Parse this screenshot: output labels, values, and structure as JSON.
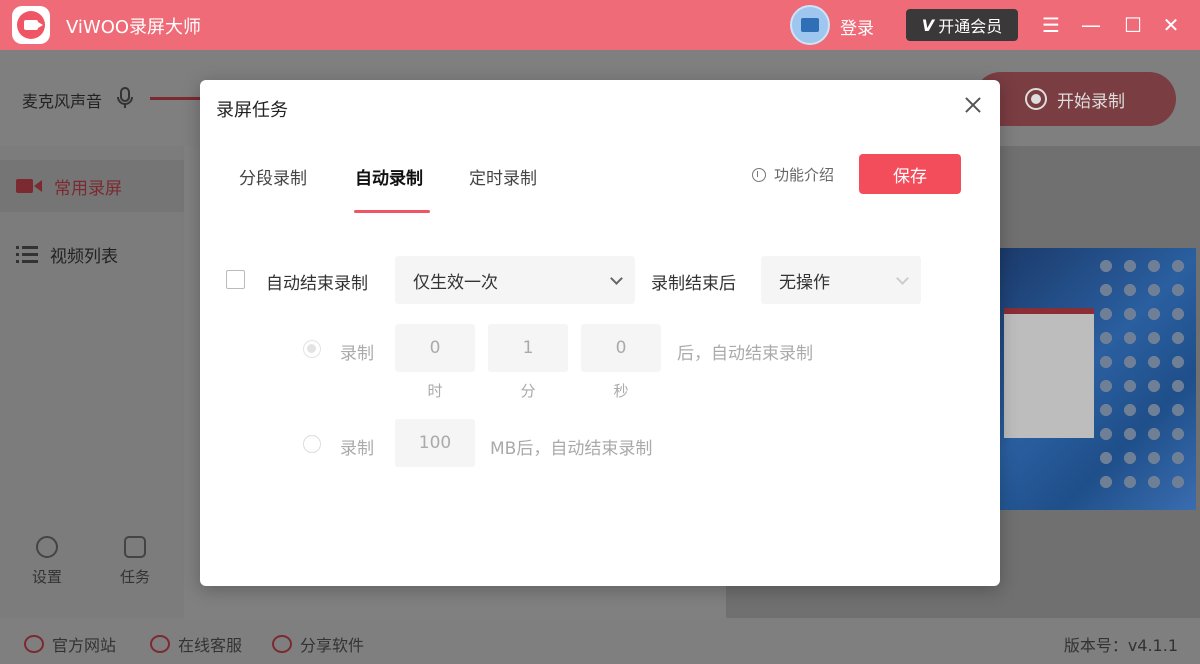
{
  "app": {
    "title": "ViWOO录屏大师",
    "login": "登录",
    "vip": "开通会员",
    "vip_mark": "V"
  },
  "toolbar": {
    "mic_label": "麦克风声音",
    "start_record": "开始录制"
  },
  "sidebar": {
    "items": [
      {
        "label": "常用录屏"
      },
      {
        "label": "视频列表"
      }
    ],
    "settings": "设置",
    "tasks": "任务"
  },
  "footer": {
    "official_site": "官方网站",
    "support": "在线客服",
    "share": "分享软件",
    "version": "版本号：v4.1.1"
  },
  "modal": {
    "title": "录屏任务",
    "tabs": [
      {
        "label": "分段录制"
      },
      {
        "label": "自动录制"
      },
      {
        "label": "定时录制"
      }
    ],
    "active_tab": "自动录制",
    "feature_intro": "功能介绍",
    "save": "保存",
    "auto_stop_label": "自动结束录制",
    "frequency_select": "仅生效一次",
    "after_label": "录制结束后",
    "after_select": "无操作",
    "duration_option": {
      "prefix": "录制",
      "hours": "0",
      "minutes": "1",
      "seconds": "0",
      "hour_unit": "时",
      "minute_unit": "分",
      "second_unit": "秒",
      "suffix": "后，自动结束录制"
    },
    "size_option": {
      "prefix": "录制",
      "size": "100",
      "suffix": "MB后，自动结束录制"
    }
  },
  "colors": {
    "accent": "#f34d5c",
    "title_bar": "#f06b78"
  }
}
